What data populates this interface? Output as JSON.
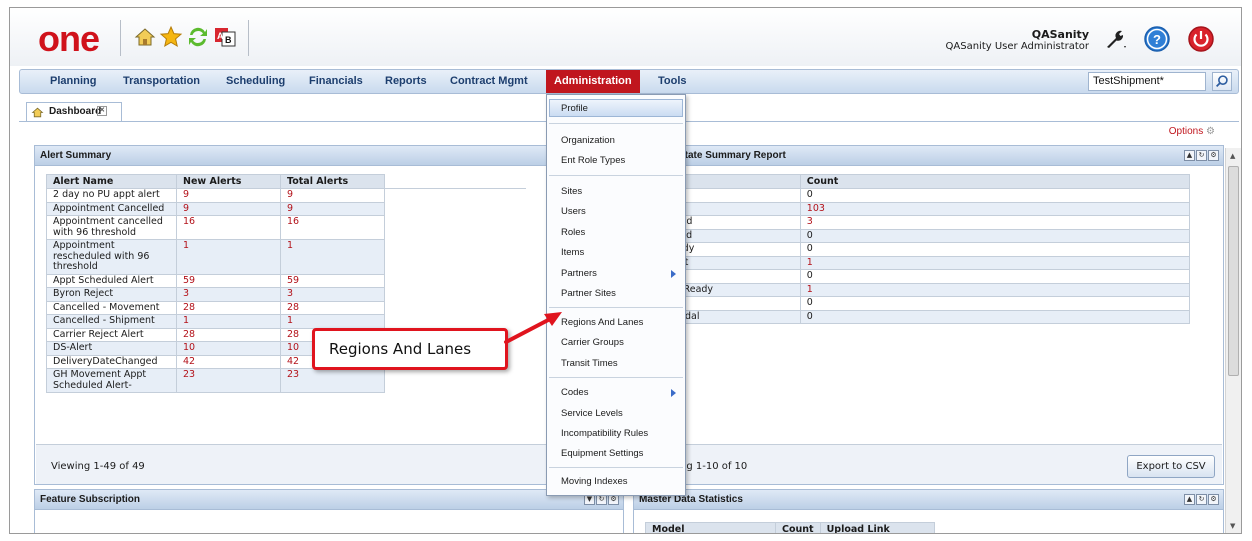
{
  "header": {
    "logo": "one",
    "user_name": "QASanity",
    "user_role": "QASanity User Administrator"
  },
  "nav": {
    "items": [
      "Planning",
      "Transportation",
      "Scheduling",
      "Financials",
      "Reports",
      "Contract Mgmt",
      "Administration",
      "Tools"
    ],
    "active": "Administration",
    "search_value": "TestShipment*"
  },
  "tabs": {
    "dashboard": "Dashboard"
  },
  "options_label": "Options",
  "alert_summary": {
    "title": "Alert Summary",
    "columns": [
      "Alert Name",
      "New Alerts",
      "Total Alerts"
    ],
    "rows": [
      [
        "2 day no PU appt alert",
        "9",
        "9"
      ],
      [
        "Appointment Cancelled",
        "9",
        "9"
      ],
      [
        "Appointment cancelled with 96 threshold",
        "16",
        "16"
      ],
      [
        "Appointment rescheduled with 96 threshold",
        "1",
        "1"
      ],
      [
        "Appt Scheduled Alert",
        "59",
        "59"
      ],
      [
        "Byron Reject",
        "3",
        "3"
      ],
      [
        "Cancelled - Movement",
        "28",
        "28"
      ],
      [
        "Cancelled - Shipment",
        "1",
        "1"
      ],
      [
        "Carrier Reject Alert",
        "28",
        "28"
      ],
      [
        "DS-Alert",
        "10",
        "10"
      ],
      [
        "DeliveryDateChanged",
        "42",
        "42"
      ],
      [
        "GH Movement Appt Scheduled Alert-",
        "23",
        "23"
      ]
    ],
    "viewing": "Viewing 1-49 of 49"
  },
  "state_summary": {
    "title": "State Summary Report",
    "columns": [
      "Count"
    ],
    "rows": [
      [
        "",
        "0"
      ],
      [
        "ng",
        "103"
      ],
      [
        "ered",
        "3"
      ],
      [
        "med",
        "0"
      ],
      [
        "eady",
        "0"
      ],
      [
        "nsit",
        "1"
      ],
      [
        "d",
        "0"
      ],
      [
        "ry Ready",
        "1"
      ],
      [
        "red",
        "0"
      ],
      [
        "Modal",
        "0"
      ]
    ],
    "viewing": "ng 1-10 of 10",
    "export_label": "Export to CSV"
  },
  "feature_subscription": {
    "title": "Feature Subscription"
  },
  "master_data": {
    "title": "Master Data Statistics",
    "columns": [
      "Model",
      "Count",
      "Upload Link"
    ]
  },
  "admin_menu": {
    "items": [
      "Profile",
      "Organization",
      "Ent Role Types",
      "Sites",
      "Users",
      "Roles",
      "Items",
      "Partners",
      "Partner Sites",
      "Regions And Lanes",
      "Carrier Groups",
      "Transit Times",
      "Codes",
      "Service Levels",
      "Incompatibility Rules",
      "Equipment Settings",
      "Moving Indexes"
    ]
  },
  "callout": {
    "text": "Regions And Lanes",
    "color": "#e0141e"
  },
  "colors": {
    "brand_red": "#c0161e",
    "nav_text": "#1d3e6e",
    "value_red": "#b3121a"
  }
}
